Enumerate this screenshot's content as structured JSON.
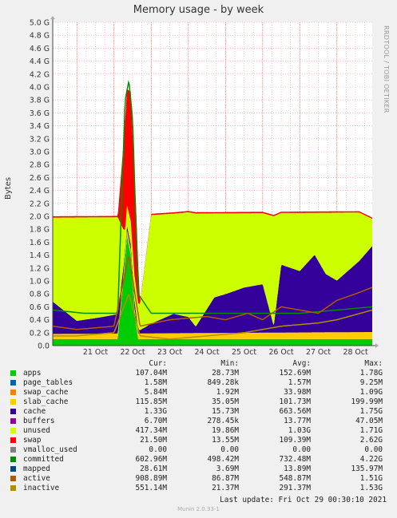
{
  "title": "Memory usage - by week",
  "side_label": "RRDTOOL / TOBI OETIKER",
  "footer": "Munin 2.0.33-1",
  "last_update": "Last update:  Fri Oct 29 00:30:10 2021",
  "legend_headers": [
    "Cur:",
    "Min:",
    "Avg:",
    "Max:"
  ],
  "colors": {
    "apps": "#00cc00",
    "page_tables": "#0066b3",
    "swap_cache": "#ff8000",
    "slab_cache": "#ffcc00",
    "cache": "#330099",
    "buffers": "#990099",
    "unused": "#ccff00",
    "swap": "#ff0000",
    "vmalloc_used": "#808080",
    "committed": "#008f00",
    "mapped": "#00487d",
    "active": "#b35a00",
    "inactive": "#b38f00"
  },
  "legend": [
    {
      "key": "apps",
      "name": "apps",
      "cur": "107.04M",
      "min": "28.73M",
      "avg": "152.69M",
      "max": "1.78G"
    },
    {
      "key": "page_tables",
      "name": "page_tables",
      "cur": "1.58M",
      "min": "849.28k",
      "avg": "1.57M",
      "max": "9.25M"
    },
    {
      "key": "swap_cache",
      "name": "swap_cache",
      "cur": "5.84M",
      "min": "1.92M",
      "avg": "33.98M",
      "max": "1.09G"
    },
    {
      "key": "slab_cache",
      "name": "slab_cache",
      "cur": "115.85M",
      "min": "35.05M",
      "avg": "101.73M",
      "max": "199.99M"
    },
    {
      "key": "cache",
      "name": "cache",
      "cur": "1.33G",
      "min": "15.73M",
      "avg": "663.56M",
      "max": "1.75G"
    },
    {
      "key": "buffers",
      "name": "buffers",
      "cur": "6.70M",
      "min": "278.45k",
      "avg": "13.77M",
      "max": "47.05M"
    },
    {
      "key": "unused",
      "name": "unused",
      "cur": "417.34M",
      "min": "19.86M",
      "avg": "1.03G",
      "max": "1.71G"
    },
    {
      "key": "swap",
      "name": "swap",
      "cur": "21.50M",
      "min": "13.55M",
      "avg": "109.39M",
      "max": "2.62G"
    },
    {
      "key": "vmalloc_used",
      "name": "vmalloc_used",
      "cur": "0.00",
      "min": "0.00",
      "avg": "0.00",
      "max": "0.00"
    },
    {
      "key": "committed",
      "name": "committed",
      "cur": "602.96M",
      "min": "498.42M",
      "avg": "732.48M",
      "max": "4.22G"
    },
    {
      "key": "mapped",
      "name": "mapped",
      "cur": "28.61M",
      "min": "3.69M",
      "avg": "13.89M",
      "max": "135.97M"
    },
    {
      "key": "active",
      "name": "active",
      "cur": "908.89M",
      "min": "86.87M",
      "avg": "548.87M",
      "max": "1.51G"
    },
    {
      "key": "inactive",
      "name": "inactive",
      "cur": "551.14M",
      "min": "21.37M",
      "avg": "291.37M",
      "max": "1.53G"
    }
  ],
  "chart_data": {
    "type": "area",
    "title": "Memory usage - by week",
    "ylabel": "Bytes",
    "ylim": [
      0,
      5.0
    ],
    "yticks": [
      "0.0",
      "0.2 G",
      "0.4 G",
      "0.6 G",
      "0.8 G",
      "1.0 G",
      "1.2 G",
      "1.4 G",
      "1.6 G",
      "1.8 G",
      "2.0 G",
      "2.2 G",
      "2.4 G",
      "2.6 G",
      "2.8 G",
      "3.0 G",
      "3.2 G",
      "3.4 G",
      "3.6 G",
      "3.8 G",
      "4.0 G",
      "4.2 G",
      "4.4 G",
      "4.6 G",
      "4.8 G",
      "5.0 G"
    ],
    "xticks": [
      "21 Oct",
      "22 Oct",
      "23 Oct",
      "24 Oct",
      "25 Oct",
      "26 Oct",
      "27 Oct",
      "28 Oct"
    ],
    "xlim_days": [
      20.35,
      28.95
    ],
    "grid": true,
    "series": [
      {
        "name": "apps",
        "type": "stack",
        "values": [
          [
            20.35,
            0.1
          ],
          [
            21.0,
            0.1
          ],
          [
            21.6,
            0.1
          ],
          [
            22.1,
            0.1
          ],
          [
            22.25,
            1.0
          ],
          [
            22.35,
            1.7
          ],
          [
            22.45,
            1.4
          ],
          [
            22.55,
            0.5
          ],
          [
            22.65,
            0.1
          ],
          [
            23.0,
            0.1
          ],
          [
            24.0,
            0.1
          ],
          [
            25.0,
            0.1
          ],
          [
            26.0,
            0.1
          ],
          [
            27.0,
            0.1
          ],
          [
            28.0,
            0.1
          ],
          [
            28.95,
            0.1
          ]
        ]
      },
      {
        "name": "slab_cache",
        "type": "stack",
        "values": [
          [
            20.35,
            0.08
          ],
          [
            28.95,
            0.11
          ]
        ]
      },
      {
        "name": "cache",
        "type": "stack",
        "values": [
          [
            20.35,
            0.5
          ],
          [
            21.0,
            0.2
          ],
          [
            21.6,
            0.25
          ],
          [
            22.1,
            0.3
          ],
          [
            22.3,
            0.05
          ],
          [
            22.55,
            0.1
          ],
          [
            22.7,
            0.05
          ],
          [
            23.0,
            0.15
          ],
          [
            23.6,
            0.3
          ],
          [
            24.0,
            0.25
          ],
          [
            24.2,
            0.1
          ],
          [
            24.7,
            0.55
          ],
          [
            25.0,
            0.6
          ],
          [
            25.5,
            0.7
          ],
          [
            26.0,
            0.75
          ],
          [
            26.3,
            0.1
          ],
          [
            26.5,
            1.05
          ],
          [
            27.0,
            0.95
          ],
          [
            27.4,
            1.2
          ],
          [
            27.7,
            0.9
          ],
          [
            28.0,
            0.8
          ],
          [
            28.6,
            1.1
          ],
          [
            28.95,
            1.33
          ]
        ]
      },
      {
        "name": "unused",
        "type": "stack",
        "values": [
          [
            20.35,
            1.3
          ],
          [
            21.0,
            1.6
          ],
          [
            21.6,
            1.55
          ],
          [
            22.1,
            1.5
          ],
          [
            22.3,
            0.3
          ],
          [
            22.55,
            0.4
          ],
          [
            22.7,
            0.4
          ],
          [
            23.0,
            1.68
          ],
          [
            23.6,
            1.55
          ],
          [
            24.0,
            1.62
          ],
          [
            24.2,
            1.75
          ],
          [
            24.7,
            1.3
          ],
          [
            25.0,
            1.25
          ],
          [
            25.5,
            1.15
          ],
          [
            26.0,
            1.1
          ],
          [
            26.3,
            1.7
          ],
          [
            26.5,
            0.8
          ],
          [
            27.0,
            0.9
          ],
          [
            27.4,
            0.65
          ],
          [
            27.7,
            0.95
          ],
          [
            28.0,
            1.05
          ],
          [
            28.6,
            0.75
          ],
          [
            28.95,
            0.42
          ]
        ]
      },
      {
        "name": "swap",
        "type": "stack",
        "values": [
          [
            20.35,
            0.02
          ],
          [
            22.1,
            0.02
          ],
          [
            22.3,
            1.7
          ],
          [
            22.45,
            2.0
          ],
          [
            22.6,
            1.2
          ],
          [
            22.7,
            0.02
          ],
          [
            28.95,
            0.02
          ]
        ]
      },
      {
        "name": "committed",
        "type": "line",
        "values": [
          [
            20.35,
            0.55
          ],
          [
            21.2,
            0.5
          ],
          [
            22.1,
            0.5
          ],
          [
            22.3,
            3.8
          ],
          [
            22.4,
            4.1
          ],
          [
            22.5,
            3.5
          ],
          [
            22.65,
            0.8
          ],
          [
            23.0,
            0.5
          ],
          [
            24.0,
            0.5
          ],
          [
            25.0,
            0.5
          ],
          [
            26.0,
            0.5
          ],
          [
            27.0,
            0.5
          ],
          [
            28.0,
            0.55
          ],
          [
            28.95,
            0.6
          ]
        ]
      },
      {
        "name": "active",
        "type": "line",
        "values": [
          [
            20.35,
            0.3
          ],
          [
            21.0,
            0.25
          ],
          [
            22.0,
            0.3
          ],
          [
            22.4,
            1.4
          ],
          [
            22.7,
            0.3
          ],
          [
            23.5,
            0.4
          ],
          [
            24.5,
            0.45
          ],
          [
            25.0,
            0.4
          ],
          [
            25.6,
            0.5
          ],
          [
            26.0,
            0.4
          ],
          [
            26.5,
            0.6
          ],
          [
            27.0,
            0.55
          ],
          [
            27.5,
            0.5
          ],
          [
            28.0,
            0.7
          ],
          [
            28.5,
            0.8
          ],
          [
            28.95,
            0.9
          ]
        ]
      },
      {
        "name": "inactive",
        "type": "line",
        "values": [
          [
            20.35,
            0.15
          ],
          [
            21.0,
            0.15
          ],
          [
            22.0,
            0.2
          ],
          [
            22.4,
            0.8
          ],
          [
            22.7,
            0.15
          ],
          [
            23.5,
            0.1
          ],
          [
            24.5,
            0.15
          ],
          [
            25.5,
            0.2
          ],
          [
            26.5,
            0.3
          ],
          [
            27.5,
            0.35
          ],
          [
            28.0,
            0.4
          ],
          [
            28.95,
            0.55
          ]
        ]
      }
    ]
  }
}
